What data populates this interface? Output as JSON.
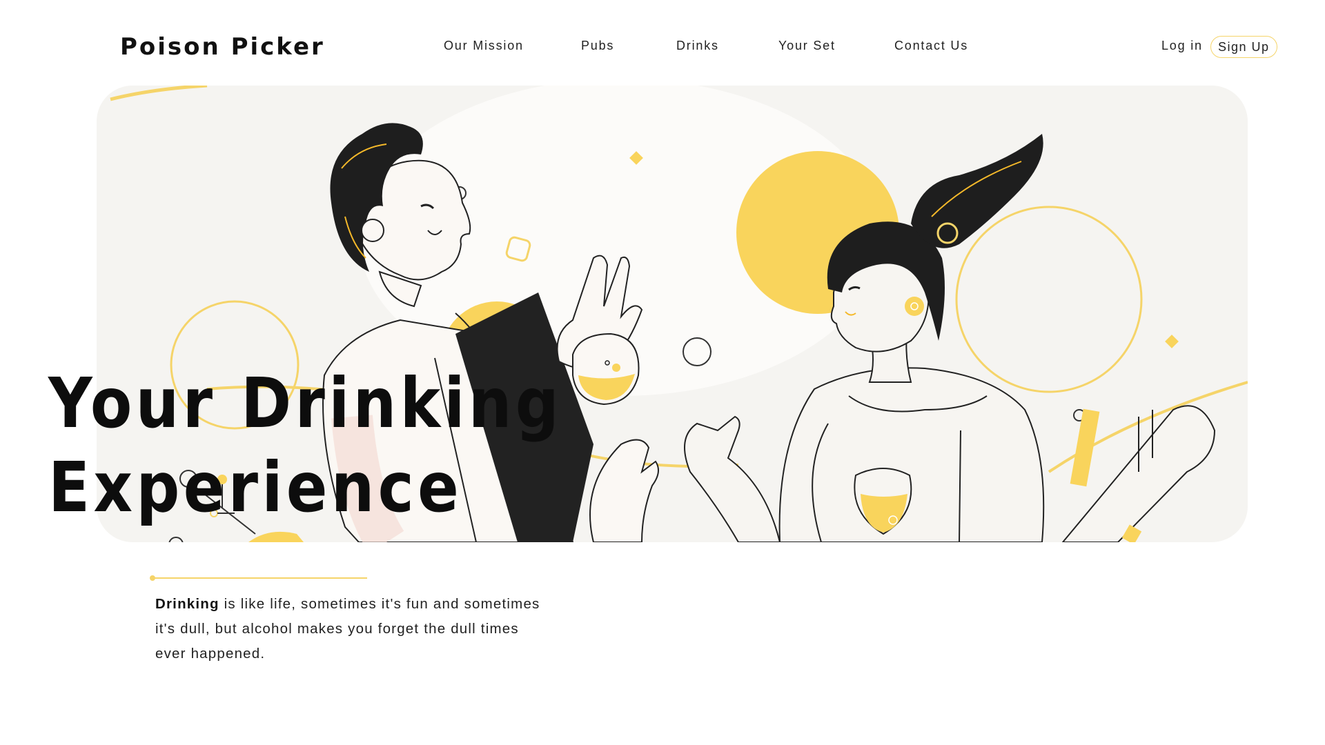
{
  "header": {
    "brand": "Poison Picker",
    "nav": [
      "Our Mission",
      "Pubs",
      "Drinks",
      "Your Set",
      "Contact Us"
    ],
    "login_label": "Log in",
    "signup_label": "Sign Up"
  },
  "hero": {
    "title_line1": "Your Drinking",
    "title_line2": "Experience",
    "illustration": "two-people-toasting-with-wine-glasses"
  },
  "intro": {
    "bold": "Drinking",
    "text": " is like life, sometimes it's fun and sometimes it's dull, but alcohol makes you forget the dull times ever happened."
  },
  "colors": {
    "accent": "#f5d469",
    "dark": "#111111",
    "hero_bg": "#f5f4f1"
  }
}
